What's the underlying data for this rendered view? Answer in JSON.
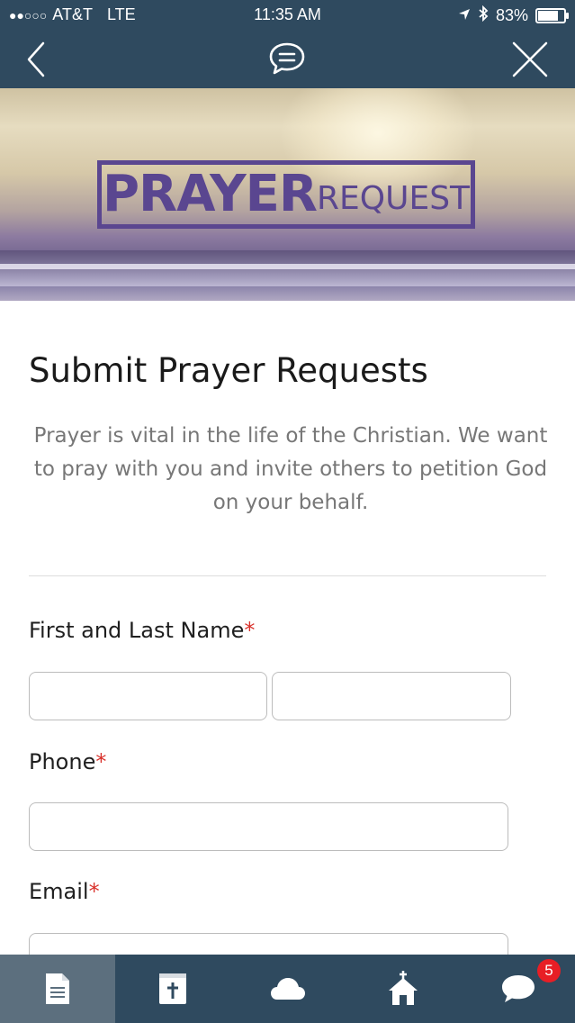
{
  "status_bar": {
    "signal_dots": "●●○○○",
    "carrier": "AT&T",
    "network": "LTE",
    "time": "11:35 AM",
    "battery_percent": "83%",
    "battery_level": 0.83
  },
  "nav": {
    "back_icon": "chevron-left-icon",
    "center_icon": "chat-bubble-icon",
    "close_icon": "close-icon"
  },
  "hero": {
    "logo_big": "PRAYER",
    "logo_small": "REQUEST"
  },
  "content": {
    "title": "Submit Prayer Requests",
    "description": "Prayer is vital in the life of the Christian. We want to pray with you and invite others to petition God on your behalf."
  },
  "form": {
    "name_label": "First and Last Name",
    "phone_label": "Phone",
    "email_label": "Email",
    "required_mark": "*"
  },
  "tab_bar": {
    "tabs": [
      {
        "icon": "document-icon",
        "active": true
      },
      {
        "icon": "bible-icon",
        "active": false
      },
      {
        "icon": "cloud-icon",
        "active": false
      },
      {
        "icon": "church-icon",
        "active": false
      },
      {
        "icon": "chat-icon",
        "active": false,
        "badge": "5"
      }
    ]
  },
  "colors": {
    "bar": "#2f4a5f",
    "active_tab": "#5c6f7e",
    "logo": "#5a4690",
    "required": "#d9312b",
    "badge": "#e81e25"
  }
}
